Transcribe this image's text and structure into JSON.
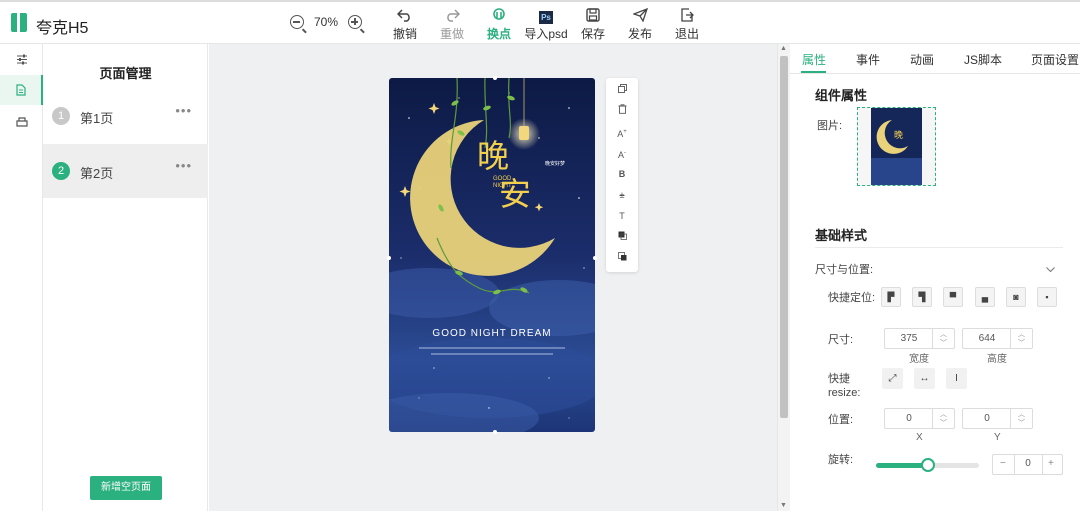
{
  "app": {
    "title": "夸克H5"
  },
  "toolbar": {
    "zoom_value": "70%",
    "undo": "撤销",
    "redo": "重做",
    "swap": "换点",
    "import_psd": "导入psd",
    "save": "保存",
    "publish": "发布",
    "exit": "退出"
  },
  "rail": {
    "items": [
      "settings-icon",
      "page-icon",
      "layers-icon"
    ]
  },
  "pages": {
    "title": "页面管理",
    "items": [
      {
        "num": "1",
        "label": "第1页",
        "more": "•••"
      },
      {
        "num": "2",
        "label": "第2页",
        "more": "•••"
      }
    ],
    "add_button": "新增空页面"
  },
  "poster": {
    "big_char_1": "晚",
    "big_char_2": "安",
    "good_night": "GOOD\nNIGHT",
    "tagline": "晚安好梦",
    "headline": "GOOD NIGHT DREAM"
  },
  "float_tools": [
    "copy-icon",
    "delete-icon",
    "font-size-up-icon",
    "font-size-down-icon",
    "bold-icon",
    "strikethrough-icon",
    "text-style-icon",
    "bring-front-icon",
    "send-back-icon"
  ],
  "right": {
    "tabs": [
      "属性",
      "事件",
      "动画",
      "JS脚本",
      "页面设置"
    ],
    "component_title": "组件属性",
    "image_label": "图片:",
    "basic_style_title": "基础样式",
    "size_position_label": "尺寸与位置:",
    "quick_position_label": "快捷定位:",
    "size_label": "尺寸:",
    "width_value": "375",
    "height_value": "644",
    "width_label": "宽度",
    "height_label": "高度",
    "quick_resize_label_1": "快捷",
    "quick_resize_label_2": "resize:",
    "position_label": "位置:",
    "x_value": "0",
    "y_value": "0",
    "x_label": "X",
    "y_label": "Y",
    "rotate_label": "旋转:",
    "rotate_value": "0",
    "rotate_slider_level": 0.5,
    "minus": "−",
    "plus": "+"
  },
  "colors": {
    "accent": "#2bb07f",
    "poster_bg": "#0f1c4d",
    "moon": "#e9d27a"
  }
}
